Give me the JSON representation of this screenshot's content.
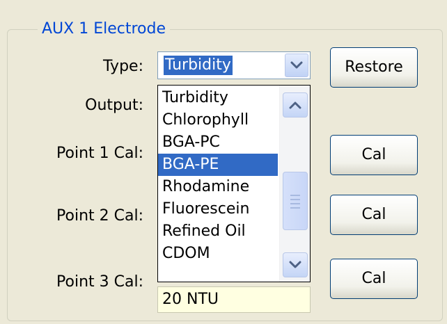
{
  "group": {
    "title": "AUX 1 Electrode"
  },
  "labels": {
    "type": "Type:",
    "output": "Output:",
    "point1": "Point 1 Cal:",
    "point2": "Point 2 Cal:",
    "point3": "Point 3 Cal:"
  },
  "type_combo": {
    "value": "Turbidity"
  },
  "dropdown": {
    "items": [
      "Turbidity",
      "Chlorophyll",
      "BGA-PC",
      "BGA-PE",
      "Rhodamine",
      "Fluorescein",
      "Refined Oil",
      "CDOM"
    ],
    "selected": "BGA-PE"
  },
  "buttons": {
    "restore": "Restore",
    "cal1": "Cal",
    "cal2": "Cal",
    "cal3": "Cal"
  },
  "point3_input": {
    "value": "20 NTU"
  },
  "icons": {
    "combo_arrow": "chevron-down-icon",
    "scroll_up": "chevron-up-icon",
    "scroll_down": "chevron-down-icon",
    "scroll_thumb": "scroll-grip-icon"
  },
  "colors": {
    "background": "#ECE9D8",
    "group_title": "#0046D5",
    "selection": "#316AC5",
    "input_background": "#FFFFE1",
    "button_border": "#003C74"
  }
}
